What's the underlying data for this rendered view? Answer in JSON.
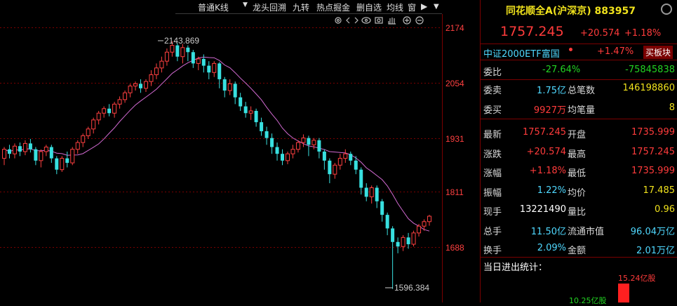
{
  "toolbar": {
    "dropdown_label": "普通K线",
    "items": [
      "龙头回溯",
      "九转",
      "热点掘金",
      "删自选",
      "均线",
      "窗"
    ]
  },
  "chart": {
    "y_ticks": [
      "2174",
      "2054",
      "1931",
      "1811",
      "1688"
    ],
    "high_label": "2143.869",
    "low_label": "1596.384",
    "ma_color": "#d26ad2",
    "up_color": "#ff4040",
    "down_color": "#38e0e0"
  },
  "chart_data": {
    "type": "candlestick",
    "ylim": [
      1560,
      2200
    ],
    "y_ticks": [
      2174,
      2054,
      1931,
      1811,
      1688
    ],
    "annotations": [
      {
        "text": "2143.869",
        "value": 2143.869
      },
      {
        "text": "1596.384",
        "value": 1596.384
      }
    ],
    "candles": [
      [
        1885,
        1905,
        1870,
        1910
      ],
      [
        1905,
        1895,
        1885,
        1915
      ],
      [
        1895,
        1912,
        1885,
        1918
      ],
      [
        1912,
        1900,
        1890,
        1920
      ],
      [
        1900,
        1918,
        1892,
        1925
      ],
      [
        1918,
        1905,
        1898,
        1928
      ],
      [
        1905,
        1880,
        1870,
        1910
      ],
      [
        1880,
        1900,
        1865,
        1905
      ],
      [
        1900,
        1910,
        1890,
        1915
      ],
      [
        1910,
        1885,
        1875,
        1915
      ],
      [
        1885,
        1860,
        1850,
        1890
      ],
      [
        1860,
        1885,
        1855,
        1890
      ],
      [
        1885,
        1875,
        1865,
        1900
      ],
      [
        1875,
        1905,
        1870,
        1910
      ],
      [
        1905,
        1920,
        1895,
        1925
      ],
      [
        1920,
        1935,
        1910,
        1940
      ],
      [
        1935,
        1950,
        1928,
        1955
      ],
      [
        1950,
        1970,
        1940,
        1975
      ],
      [
        1970,
        1985,
        1960,
        1990
      ],
      [
        1985,
        1995,
        1975,
        2000
      ],
      [
        1995,
        1985,
        1978,
        2005
      ],
      [
        1985,
        2005,
        1975,
        2010
      ],
      [
        2005,
        2015,
        1995,
        2022
      ],
      [
        2015,
        2030,
        2008,
        2035
      ],
      [
        2030,
        2045,
        2020,
        2050
      ],
      [
        2045,
        2050,
        2035,
        2055
      ],
      [
        2050,
        2040,
        2030,
        2060
      ],
      [
        2040,
        2055,
        2032,
        2060
      ],
      [
        2055,
        2070,
        2045,
        2080
      ],
      [
        2070,
        2085,
        2060,
        2095
      ],
      [
        2085,
        2100,
        2075,
        2110
      ],
      [
        2100,
        2120,
        2090,
        2128
      ],
      [
        2120,
        2135,
        2110,
        2144
      ],
      [
        2135,
        2110,
        2100,
        2140
      ],
      [
        2110,
        2130,
        2095,
        2138
      ],
      [
        2130,
        2120,
        2100,
        2135
      ],
      [
        2120,
        2095,
        2085,
        2125
      ],
      [
        2095,
        2105,
        2080,
        2110
      ],
      [
        2105,
        2090,
        2075,
        2115
      ],
      [
        2090,
        2075,
        2060,
        2100
      ],
      [
        2075,
        2095,
        2065,
        2100
      ],
      [
        2095,
        2060,
        2040,
        2098
      ],
      [
        2060,
        2035,
        2020,
        2065
      ],
      [
        2035,
        2050,
        2025,
        2060
      ],
      [
        2050,
        2020,
        2005,
        2055
      ],
      [
        2020,
        2000,
        1990,
        2030
      ],
      [
        2000,
        1985,
        1975,
        2010
      ],
      [
        1985,
        1990,
        1970,
        2000
      ],
      [
        1990,
        1965,
        1955,
        1995
      ],
      [
        1965,
        1945,
        1935,
        1975
      ],
      [
        1945,
        1930,
        1915,
        1955
      ],
      [
        1930,
        1910,
        1895,
        1940
      ],
      [
        1910,
        1895,
        1880,
        1920
      ],
      [
        1895,
        1880,
        1870,
        1905
      ],
      [
        1880,
        1895,
        1872,
        1900
      ],
      [
        1895,
        1905,
        1885,
        1915
      ],
      [
        1905,
        1920,
        1898,
        1925
      ],
      [
        1920,
        1930,
        1910,
        1938
      ],
      [
        1930,
        1915,
        1890,
        1935
      ],
      [
        1915,
        1925,
        1905,
        1930
      ],
      [
        1925,
        1900,
        1885,
        1930
      ],
      [
        1900,
        1880,
        1860,
        1905
      ],
      [
        1880,
        1850,
        1830,
        1885
      ],
      [
        1850,
        1870,
        1840,
        1875
      ],
      [
        1870,
        1885,
        1860,
        1895
      ],
      [
        1885,
        1895,
        1875,
        1905
      ],
      [
        1895,
        1880,
        1870,
        1900
      ],
      [
        1880,
        1860,
        1850,
        1890
      ],
      [
        1860,
        1820,
        1805,
        1865
      ],
      [
        1820,
        1800,
        1790,
        1830
      ],
      [
        1800,
        1820,
        1785,
        1825
      ],
      [
        1820,
        1790,
        1775,
        1825
      ],
      [
        1790,
        1760,
        1745,
        1795
      ],
      [
        1760,
        1730,
        1715,
        1765
      ],
      [
        1730,
        1700,
        1596,
        1735
      ],
      [
        1700,
        1690,
        1675,
        1710
      ],
      [
        1690,
        1710,
        1680,
        1715
      ],
      [
        1710,
        1695,
        1685,
        1720
      ],
      [
        1695,
        1720,
        1690,
        1725
      ],
      [
        1720,
        1735,
        1712,
        1740
      ],
      [
        1735,
        1745,
        1725,
        1750
      ],
      [
        1745,
        1757,
        1736,
        1760
      ]
    ]
  },
  "panel": {
    "title": "同花顺全A(沪深京) 883957",
    "last": "1757.245",
    "change": "+20.574",
    "pct": "+1.18%",
    "etf_name": "中证2000ETF富国",
    "etf_pct": "+1.47%",
    "sell_block_label": "买板块",
    "wb_label": "委比",
    "wb_pct": "-27.64%",
    "wb_val": "-75845838",
    "rows": [
      {
        "l1": "委卖",
        "v1": "1.75亿",
        "l2": "总笔数",
        "v2": "146198860",
        "c1": "cyan",
        "c2": "yel"
      },
      {
        "l1": "委买",
        "v1": "9927万",
        "l2": "均笔量",
        "v2": "8",
        "c1": "red",
        "c2": "yel"
      },
      {
        "l1": "最新",
        "v1": "1757.245",
        "l2": "开盘",
        "v2": "1735.999",
        "c1": "red",
        "c2": "red"
      },
      {
        "l1": "涨跌",
        "v1": "+20.574",
        "l2": "最高",
        "v2": "1757.245",
        "c1": "red",
        "c2": "red"
      },
      {
        "l1": "涨幅",
        "v1": "+1.18%",
        "l2": "最低",
        "v2": "1735.999",
        "c1": "red",
        "c2": "red"
      },
      {
        "l1": "振幅",
        "v1": "1.22%",
        "l2": "均价",
        "v2": "17.485",
        "c1": "cyan",
        "c2": "yel"
      },
      {
        "l1": "现手",
        "v1": "13221490",
        "l2": "量比",
        "v2": "0.96",
        "c1": "wht",
        "c2": "yel"
      },
      {
        "l1": "总手",
        "v1": "11.50亿",
        "l2": "流通市值",
        "v2": "96.04万亿",
        "c1": "cyan",
        "c2": "cyan"
      },
      {
        "l1": "换手",
        "v1": "2.09%",
        "l2": "金额",
        "v2": "2.01万亿",
        "c1": "cyan",
        "c2": "cyan"
      }
    ],
    "stats_title": "当日进出统计：",
    "stats_bar_label": "15.24亿股",
    "stats_bar2_label": "10.25亿股"
  }
}
